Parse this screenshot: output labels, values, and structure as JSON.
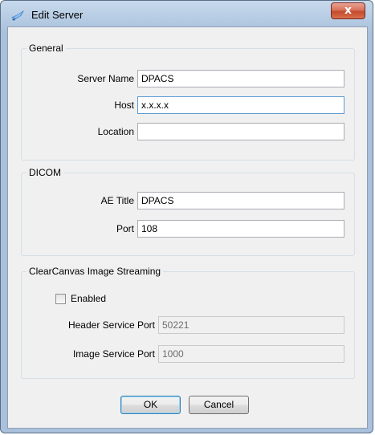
{
  "window": {
    "title": "Edit Server",
    "close_label": "x"
  },
  "general": {
    "group_label": "General",
    "server_name": {
      "label": "Server Name",
      "value": "DPACS"
    },
    "host": {
      "label": "Host",
      "value": "x.x.x.x"
    },
    "location": {
      "label": "Location",
      "value": ""
    }
  },
  "dicom": {
    "group_label": "DICOM",
    "ae_title": {
      "label": "AE Title",
      "value": "DPACS"
    },
    "port": {
      "label": "Port",
      "value": "108"
    }
  },
  "streaming": {
    "group_label": "ClearCanvas Image Streaming",
    "enabled_label": "Enabled",
    "enabled_checked": false,
    "header_port": {
      "label": "Header Service Port",
      "value": "50221"
    },
    "image_port": {
      "label": "Image Service Port",
      "value": "1000"
    }
  },
  "buttons": {
    "ok": "OK",
    "cancel": "Cancel"
  },
  "colors": {
    "focus_border": "#5b9bd5",
    "close_red": "#c44a2c"
  }
}
